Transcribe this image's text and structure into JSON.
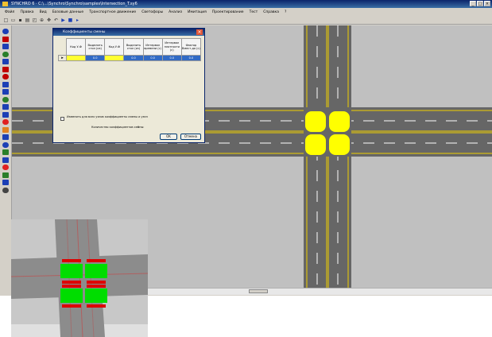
{
  "window": {
    "title": "SYNCHRO 6 · C:\\...\\Synchro\\Synchro\\samples\\Intersection_T.sy6",
    "min_symbol": "_",
    "max_symbol": "□",
    "close_symbol": "×"
  },
  "menu": [
    "Файл",
    "Правка",
    "Вид",
    "Базовые данные",
    "Транспортное движение",
    "Светофоры",
    "Анализ",
    "Имитация",
    "Проектирование",
    "Тест",
    "Справка",
    "?"
  ],
  "toolbar": {
    "icons": [
      "new-icon",
      "open-icon",
      "save-icon",
      "print-icon",
      "preview-icon",
      "zoom-icon",
      "pan-icon",
      "undo-icon",
      "play-icon",
      "stop-icon",
      "run-icon"
    ]
  },
  "left_toolbar": {
    "icons": [
      "select-icon",
      "node-icon",
      "link-icon",
      "bend-icon",
      "lane-icon",
      "signal-icon",
      "detector-icon",
      "phase-icon",
      "timing-icon",
      "flow-icon",
      "volume-icon",
      "report-icon",
      "stop-sign-icon",
      "yield-icon",
      "camera-icon",
      "pedestrian-icon",
      "bus-icon",
      "bike-icon",
      "warning-icon",
      "zone-icon",
      "info-icon",
      "grid-icon"
    ],
    "colors": [
      "#1c3fb5",
      "#c00000",
      "#1c3fb5",
      "#2a7f2a",
      "#1c3fb5",
      "#c00000",
      "#c00000",
      "#1c3fb5",
      "#1c3fb5",
      "#2a7f2a",
      "#1c3fb5",
      "#1c3fb5",
      "#e02020",
      "#e08020",
      "#1c3fb5",
      "#1c3fb5",
      "#2a7f2a",
      "#1c3fb5",
      "#e02020",
      "#2a7f2a",
      "#1c3fb5",
      "#444444"
    ]
  },
  "dialog": {
    "title": "Коэффициенты смены",
    "close_symbol": "×",
    "columns": [
      "Код У-Ф",
      "Выделить стол (из)",
      "Код У-Ф",
      "Выделить стол (из)",
      "Интервал времени (с)",
      "Интервал плотности (с)",
      "Фактор Вмест-до (с)"
    ],
    "rows": [
      [
        "",
        "0.0",
        "",
        "0.0",
        "0.0",
        "0.0",
        "0.0"
      ]
    ],
    "row_marker": "▸",
    "checkbox_label": "Изменить для всех узлов коэффициенты смены и узел",
    "summary_label": "Количество коэффициентов смены:",
    "summary_value": "1",
    "ok_label": "OK",
    "cancel_label": "Отмена"
  },
  "colors": {
    "road": "#666666",
    "lane_line": "#ffffff",
    "edge_line": "#f0d000",
    "signal": "#ffff00",
    "inset_green": "#00dd00",
    "inset_red": "#dd0000"
  }
}
